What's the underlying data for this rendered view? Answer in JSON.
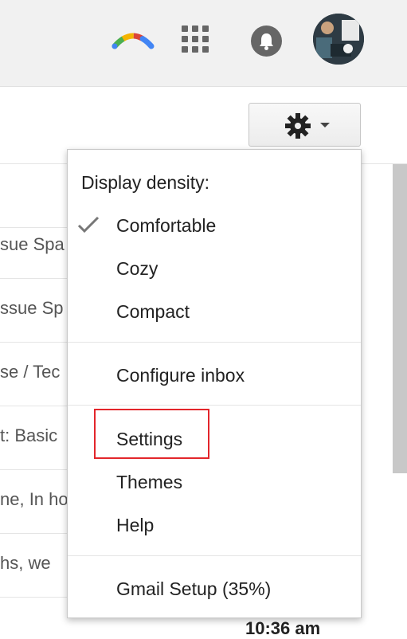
{
  "header": {
    "logo_icon": "multicolor-arc-icon",
    "apps_icon": "apps-grid-icon",
    "notifications_icon": "bell-icon",
    "avatar": "profile-avatar"
  },
  "toolbar": {
    "settings_button_icon": "gear-icon",
    "dropdown_icon": "caret-down-icon"
  },
  "email_list": {
    "rows": [
      {
        "snippet": "sue Spa"
      },
      {
        "snippet": "ssue Sp"
      },
      {
        "snippet": "se / Tec"
      },
      {
        "snippet": "t: Basic"
      },
      {
        "snippet": "ne, In ho"
      },
      {
        "snippet": "hs, we"
      }
    ],
    "timestamp": "10:36 am"
  },
  "menu": {
    "density_heading": "Display density:",
    "density_options": [
      {
        "label": "Comfortable",
        "selected": true
      },
      {
        "label": "Cozy",
        "selected": false
      },
      {
        "label": "Compact",
        "selected": false
      }
    ],
    "configure_inbox": "Configure inbox",
    "settings": "Settings",
    "themes": "Themes",
    "help": "Help",
    "gmail_setup": "Gmail Setup (35%)"
  },
  "colors": {
    "highlight": "#e3262b",
    "icon_gray": "#666666",
    "header_bg": "#f1f1f1"
  }
}
